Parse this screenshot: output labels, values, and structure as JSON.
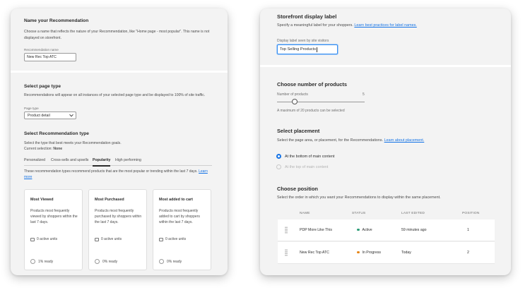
{
  "left": {
    "name_section": {
      "title": "Name your Recommendation",
      "description": "Choose a name that reflects the nature of your Recommendation, like \"Home page - most popular\". This name is not displayed on storefront.",
      "field_label": "Recommendation name",
      "field_value": "New Rec Top ATC"
    },
    "page_type_section": {
      "title": "Select page type",
      "description": "Recommendations will appear on all instances of your selected page type and be displayed to 100% of site traffic.",
      "field_label": "Page type",
      "selected_value": "Product detail"
    },
    "rec_type_section": {
      "title": "Select Recommendation type",
      "description": "Select the type that best meets your Recommendation goals.",
      "current_selection_label": "Current selection:",
      "current_selection_value": "None",
      "tabs": [
        "Personalized",
        "Cross-sells and upsells",
        "Popularity",
        "High performing"
      ],
      "selected_tab": "Popularity",
      "tab_description": "These recommendation types recommend products that are the most popular or trending within the last 7 days.",
      "learn_more": "Learn more",
      "cards": [
        {
          "title": "Most Viewed",
          "description": "Products most frequently viewed by shoppers within the last 7 days.",
          "units": "0 active units",
          "ready": "1% ready"
        },
        {
          "title": "Most Purchased",
          "description": "Products most frequently purchased by shoppers within the last 7 days.",
          "units": "0 active units",
          "ready": "0% ready"
        },
        {
          "title": "Most added to cart",
          "description": "Products most frequently added to cart by shoppers within the last 7 days.",
          "units": "0 active units",
          "ready": "0% ready"
        }
      ]
    }
  },
  "right": {
    "label_section": {
      "title": "Storefront display label",
      "description": "Specify a meaningful label for your shoppers.",
      "link": "Learn best practices for label names.",
      "field_label": "Display label seen by site visitors",
      "field_value": "Top Selling Products"
    },
    "count_section": {
      "title": "Choose number of products",
      "slider_label": "Number of products",
      "slider_value": "5",
      "slider_fraction": 0.2,
      "helper": "A maximum of 20 products can be selected"
    },
    "placement_section": {
      "title": "Select placement",
      "description": "Select the page area, or placement, for the Recommendations.",
      "link": "Learn about placement.",
      "options": [
        "At the bottom of main content",
        "At the top of main content"
      ],
      "selected_option": "At the bottom of main content"
    },
    "position_section": {
      "title": "Choose position",
      "description": "Select the order in which you want your Recommendations to display within the same placement.",
      "columns": [
        "NAME",
        "STATUS",
        "LAST EDITED",
        "POSITION"
      ],
      "rows": [
        {
          "name": "PDP More Like This",
          "status": "Active",
          "status_color": "#2d9d78",
          "edited": "59 minutes ago",
          "position": "1"
        },
        {
          "name": "New Rec Top ATC",
          "status": "In Progress",
          "status_color": "#e68619",
          "edited": "Today",
          "position": "2"
        }
      ]
    }
  }
}
